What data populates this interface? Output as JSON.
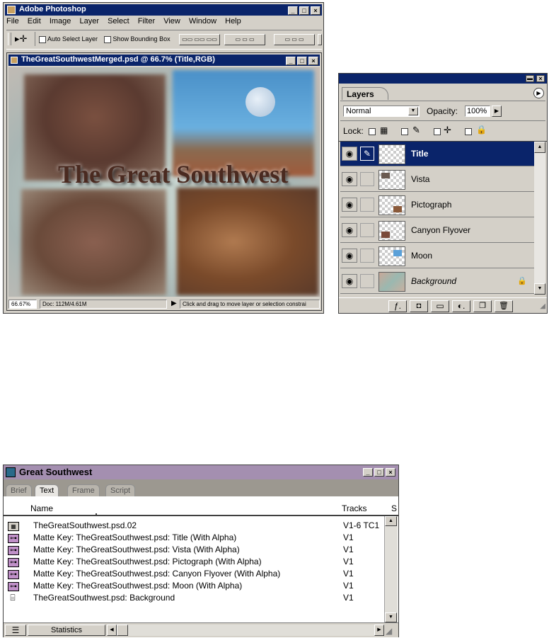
{
  "photoshop": {
    "title": "Adobe Photoshop",
    "menu": [
      "File",
      "Edit",
      "Image",
      "Layer",
      "Select",
      "Filter",
      "View",
      "Window",
      "Help"
    ],
    "options": {
      "auto_select": "Auto Select Layer",
      "bounding_box": "Show Bounding Box"
    },
    "document": {
      "title": "TheGreatSouthwestMerged.psd @ 66.7% (Title,RGB)",
      "canvas_text": "The Great Southwest",
      "zoom": "66.67%",
      "doc_size": "Doc: 112M/4.61M",
      "hint": "Click and drag to move layer or selection constrai"
    }
  },
  "layers_palette": {
    "tab": "Layers",
    "blend_mode": "Normal",
    "opacity_label": "Opacity:",
    "opacity_value": "100%",
    "lock_label": "Lock:",
    "layers": [
      {
        "name": "Title",
        "selected": true
      },
      {
        "name": "Vista",
        "selected": false
      },
      {
        "name": "Pictograph",
        "selected": false
      },
      {
        "name": "Canyon Flyover",
        "selected": false
      },
      {
        "name": "Moon",
        "selected": false
      },
      {
        "name": "Background",
        "selected": false
      }
    ]
  },
  "bin": {
    "title": "Great Southwest",
    "tabs": [
      "Brief",
      "Text",
      "Frame",
      "Script"
    ],
    "active_tab": "Text",
    "columns": {
      "name": "Name",
      "tracks": "Tracks",
      "extra": "S"
    },
    "rows": [
      {
        "icon": "sequence-icon",
        "name": "TheGreatSouthwest.psd.02",
        "tracks": "V1-6 TC1"
      },
      {
        "icon": "matte-key-icon",
        "name": "Matte Key: TheGreatSouthwest.psd: Title (With Alpha)",
        "tracks": "V1"
      },
      {
        "icon": "matte-key-icon",
        "name": "Matte Key: TheGreatSouthwest.psd: Vista (With Alpha)",
        "tracks": "V1"
      },
      {
        "icon": "matte-key-icon",
        "name": "Matte Key: TheGreatSouthwest.psd: Pictograph (With Alpha)",
        "tracks": "V1"
      },
      {
        "icon": "matte-key-icon",
        "name": "Matte Key: TheGreatSouthwest.psd: Canyon Flyover (With Alpha)",
        "tracks": "V1"
      },
      {
        "icon": "matte-key-icon",
        "name": "Matte Key: TheGreatSouthwest.psd: Moon (With Alpha)",
        "tracks": "V1"
      },
      {
        "icon": "clip-icon",
        "name": "TheGreatSouthwest.psd: Background",
        "tracks": "V1"
      }
    ],
    "bottom_button": "Statistics"
  }
}
